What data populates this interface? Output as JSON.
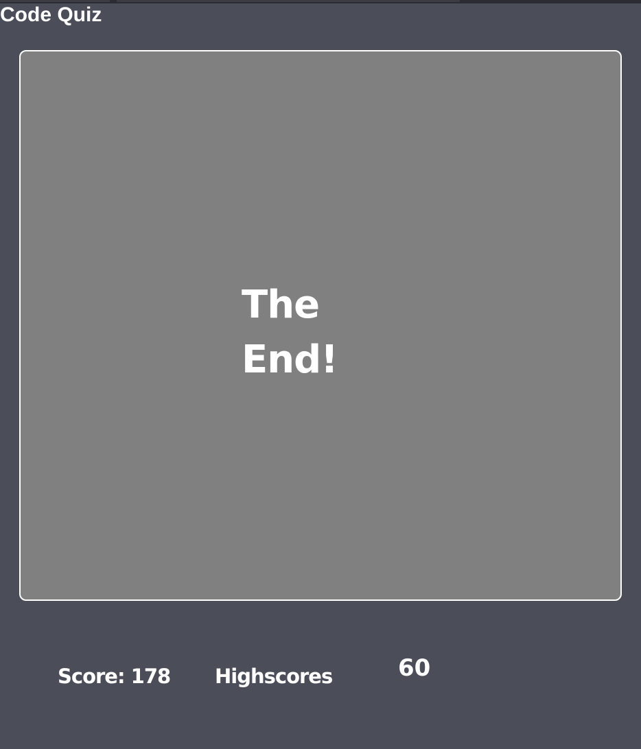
{
  "app": {
    "title": "Code Quiz"
  },
  "quiz": {
    "end_message": "The End!"
  },
  "footer": {
    "score_label": "Score: 178",
    "highscores_label": "Highscores",
    "timer_value": "60"
  },
  "colors": {
    "background": "#4b4d59",
    "card_background": "#808080",
    "card_border": "#ffffff",
    "text": "#ffffff"
  }
}
